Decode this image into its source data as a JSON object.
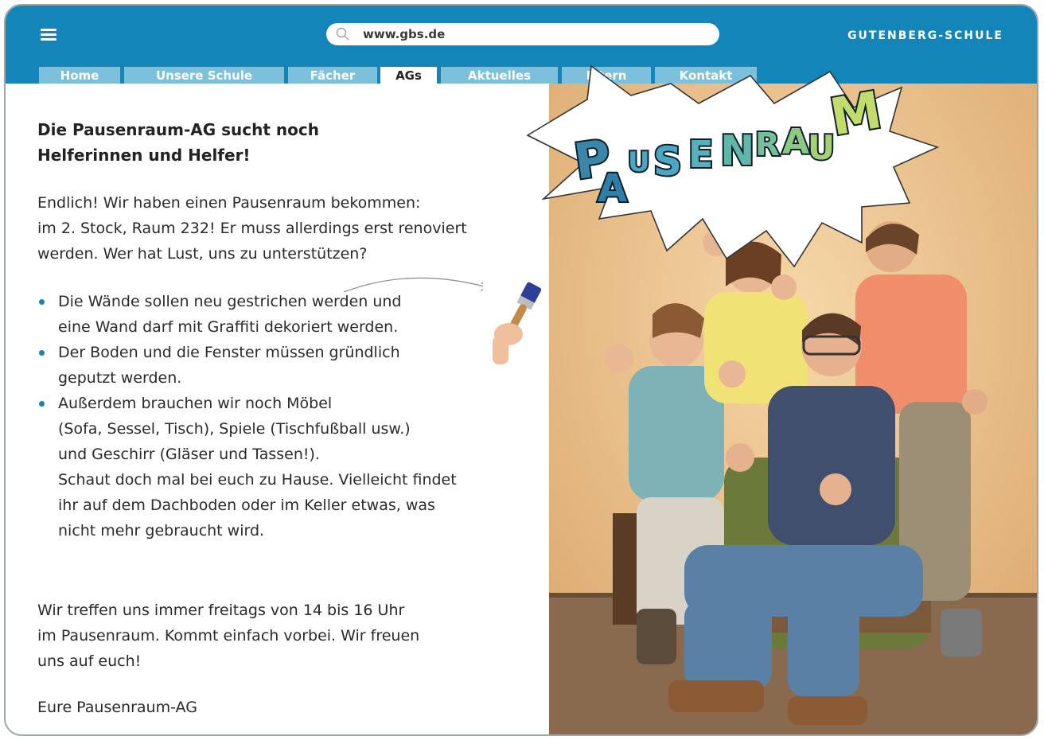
{
  "browser": {
    "url": "www.gbs.de",
    "site_name": "GUTENBERG-SCHULE",
    "menu_icon": "hamburger-menu-icon",
    "search_icon": "search-icon",
    "accent_color": "#1385b8"
  },
  "tabs": [
    {
      "label": "Home",
      "active": false
    },
    {
      "label": "Unsere Schule",
      "active": false
    },
    {
      "label": "Fächer",
      "active": false
    },
    {
      "label": "AGs",
      "active": true
    },
    {
      "label": "Aktuelles",
      "active": false
    },
    {
      "label": "Eltern",
      "active": false
    },
    {
      "label": "Kontakt",
      "active": false
    }
  ],
  "article": {
    "heading_lines": [
      "Die Pausenraum-AG sucht noch",
      "Helferinnen und Helfer!"
    ],
    "intro_lines": [
      "Endlich! Wir haben einen Pausenraum bekommen:",
      "im 2. Stock, Raum 232! Er muss allerdings erst renoviert",
      "werden. Wer hat Lust, uns zu unterstützen?"
    ],
    "bullets": [
      {
        "lines": [
          "Die Wände sollen neu gestrichen werden und",
          "eine Wand darf mit Graffiti dekoriert werden."
        ]
      },
      {
        "lines": [
          "Der Boden und die Fenster müssen gründlich",
          "geputzt werden."
        ]
      },
      {
        "lines": [
          "Außerdem brauchen wir noch Möbel",
          "(Sofa, Sessel, Tisch), Spiele (Tischfußball usw.)",
          "und Geschirr (Gläser und Tassen!).",
          "Schaut doch mal bei euch zu Hause. Vielleicht findet",
          "ihr auf dem Dachboden oder im Keller etwas, was",
          "nicht mehr gebraucht wird."
        ]
      }
    ],
    "meeting_lines": [
      "Wir treffen uns immer freitags von 14 bis 16 Uhr",
      "im Pausenraum. Kommt einfach vorbei. Wir freuen",
      "uns auf euch!"
    ],
    "signoff": "Eure Pausenraum-AG"
  },
  "graffiti": {
    "letters": [
      "P",
      "A",
      "U",
      "S",
      "E",
      "N",
      "R",
      "A",
      "U",
      "M"
    ]
  }
}
